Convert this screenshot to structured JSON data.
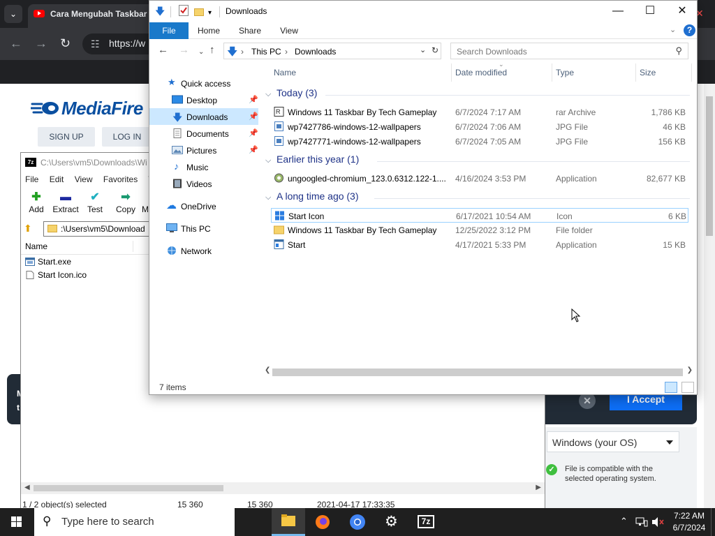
{
  "browser": {
    "tab_title": "Cara Mengubah Taskbar",
    "url": "https://w",
    "mediafire_logo": "MediaFire",
    "signup_label": "SIGN UP",
    "login_label": "LOG IN",
    "accept_label": "I Accept",
    "os_select_value": "Windows (your OS)",
    "os_compat_text": "File is compatible with the selected operating system.",
    "left_panel_text": "M\nt"
  },
  "sevenzip": {
    "title": "C:\\Users\\vm5\\Downloads\\Wi",
    "menu": [
      "File",
      "Edit",
      "View",
      "Favorites",
      "To"
    ],
    "tools": [
      "Add",
      "Extract",
      "Test",
      "Copy",
      "M"
    ],
    "path": ":\\Users\\vm5\\Download",
    "column_name": "Name",
    "files": [
      "Start.exe",
      "Start Icon.ico"
    ],
    "status": {
      "selected": "1 / 2 object(s) selected",
      "size1": "15 360",
      "size2": "15 360",
      "modified": "2021-04-17 17:33:35"
    }
  },
  "explorer": {
    "window_title": "Downloads",
    "ribbon_tabs": [
      "File",
      "Home",
      "Share",
      "View"
    ],
    "breadcrumb": [
      "This PC",
      "Downloads"
    ],
    "search_placeholder": "Search Downloads",
    "nav": {
      "quick_access": "Quick access",
      "desktop": "Desktop",
      "downloads": "Downloads",
      "documents": "Documents",
      "pictures": "Pictures",
      "music": "Music",
      "videos": "Videos",
      "onedrive": "OneDrive",
      "this_pc": "This PC",
      "network": "Network"
    },
    "columns": {
      "name": "Name",
      "date": "Date modified",
      "type": "Type",
      "size": "Size"
    },
    "groups": {
      "today": "Today (3)",
      "earlier": "Earlier this year (1)",
      "longago": "A long time ago (3)"
    },
    "files": {
      "f1": {
        "name": "Windows 11 Taskbar By Tech Gameplay",
        "date": "6/7/2024 7:17 AM",
        "type": "rar Archive",
        "size": "1,786 KB"
      },
      "f2": {
        "name": "wp7427786-windows-12-wallpapers",
        "date": "6/7/2024 7:06 AM",
        "type": "JPG File",
        "size": "46 KB"
      },
      "f3": {
        "name": "wp7427771-windows-12-wallpapers",
        "date": "6/7/2024 7:05 AM",
        "type": "JPG File",
        "size": "156 KB"
      },
      "f4": {
        "name": "ungoogled-chromium_123.0.6312.122-1....",
        "date": "4/16/2024 3:53 PM",
        "type": "Application",
        "size": "82,677 KB"
      },
      "f5": {
        "name": "Start Icon",
        "date": "6/17/2021 10:54 AM",
        "type": "Icon",
        "size": "6 KB"
      },
      "f6": {
        "name": "Windows 11 Taskbar By Tech Gameplay",
        "date": "12/25/2022 3:12 PM",
        "type": "File folder",
        "size": ""
      },
      "f7": {
        "name": "Start",
        "date": "4/17/2021 5:33 PM",
        "type": "Application",
        "size": "15 KB"
      }
    },
    "item_count": "7 items"
  },
  "taskbar": {
    "search_placeholder": "Type here to search",
    "time": "7:22 AM",
    "date": "6/7/2024",
    "zip_label": "7z"
  },
  "colors": {
    "ribbon_file": "#1979ca",
    "selection": "#cce8ff",
    "group_header": "#1e3287",
    "accept_button": "#0d6ef5"
  }
}
